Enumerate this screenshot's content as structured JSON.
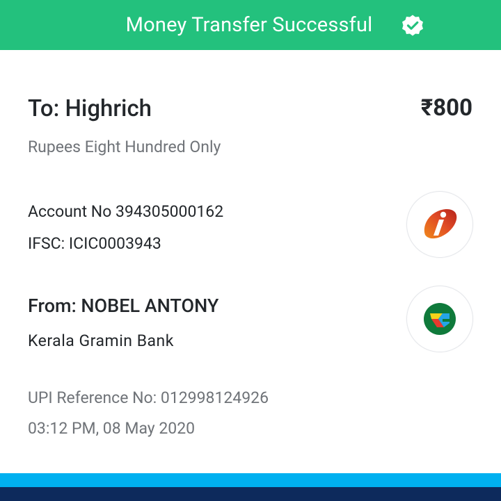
{
  "header": {
    "title": "Money Transfer Successful",
    "status_icon": "verified-badge-icon",
    "color": "#23c17d"
  },
  "recipient": {
    "to_label": "To: Highrich",
    "amount": "₹800",
    "amount_in_words": "Rupees Eight Hundred Only",
    "account_no": "Account No 394305000162",
    "ifsc": "IFSC: ICIC0003943",
    "bank_logo": "icici-bank-logo"
  },
  "sender": {
    "from_label": "From: NOBEL ANTONY",
    "bank_name": "Kerala Gramin Bank",
    "bank_logo": "kerala-gramin-bank-logo"
  },
  "transaction": {
    "upi_reference": "UPI Reference No: 012998124926",
    "datetime": "03:12 PM, 08 May 2020"
  },
  "footer": {
    "bar_light_color": "#00b0f0",
    "bar_dark_color": "#0d2a5c"
  }
}
